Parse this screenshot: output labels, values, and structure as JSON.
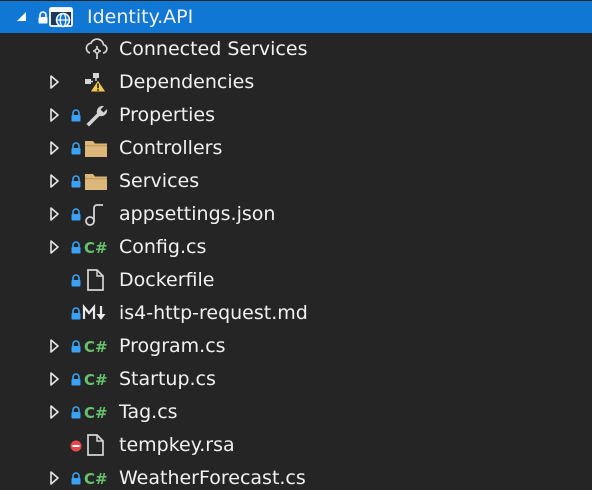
{
  "project": {
    "label": "Identity.API",
    "icon": "web-project-icon",
    "expanded": true
  },
  "items": [
    {
      "label": "Connected Services",
      "icon": "connected-services-icon",
      "expandable": false,
      "badge": "none"
    },
    {
      "label": "Dependencies",
      "icon": "dependencies-warning-icon",
      "expandable": true,
      "badge": "none"
    },
    {
      "label": "Properties",
      "icon": "wrench-icon",
      "expandable": true,
      "badge": "lock"
    },
    {
      "label": "Controllers",
      "icon": "folder-icon",
      "expandable": true,
      "badge": "lock"
    },
    {
      "label": "Services",
      "icon": "folder-icon",
      "expandable": true,
      "badge": "lock"
    },
    {
      "label": "appsettings.json",
      "icon": "json-file-icon",
      "expandable": true,
      "badge": "lock"
    },
    {
      "label": "Config.cs",
      "icon": "csharp-file-icon",
      "expandable": true,
      "badge": "lock"
    },
    {
      "label": "Dockerfile",
      "icon": "file-icon",
      "expandable": false,
      "badge": "lock"
    },
    {
      "label": "is4-http-request.md",
      "icon": "markdown-file-icon",
      "expandable": false,
      "badge": "lock"
    },
    {
      "label": "Program.cs",
      "icon": "csharp-file-icon",
      "expandable": true,
      "badge": "lock"
    },
    {
      "label": "Startup.cs",
      "icon": "csharp-file-icon",
      "expandable": true,
      "badge": "lock"
    },
    {
      "label": "Tag.cs",
      "icon": "csharp-file-icon",
      "expandable": true,
      "badge": "lock"
    },
    {
      "label": "tempkey.rsa",
      "icon": "file-icon",
      "expandable": false,
      "badge": "excluded"
    },
    {
      "label": "WeatherForecast.cs",
      "icon": "csharp-file-icon",
      "expandable": true,
      "badge": "lock"
    }
  ],
  "colors": {
    "background": "#252526",
    "selection": "#1177d4",
    "text": "#f1f1f1",
    "lock_badge": "#3ba1f5",
    "excluded_badge": "#e8474b",
    "csharp": "#67c06b",
    "folder": "#dcb67a",
    "warning": "#f2c94c"
  }
}
